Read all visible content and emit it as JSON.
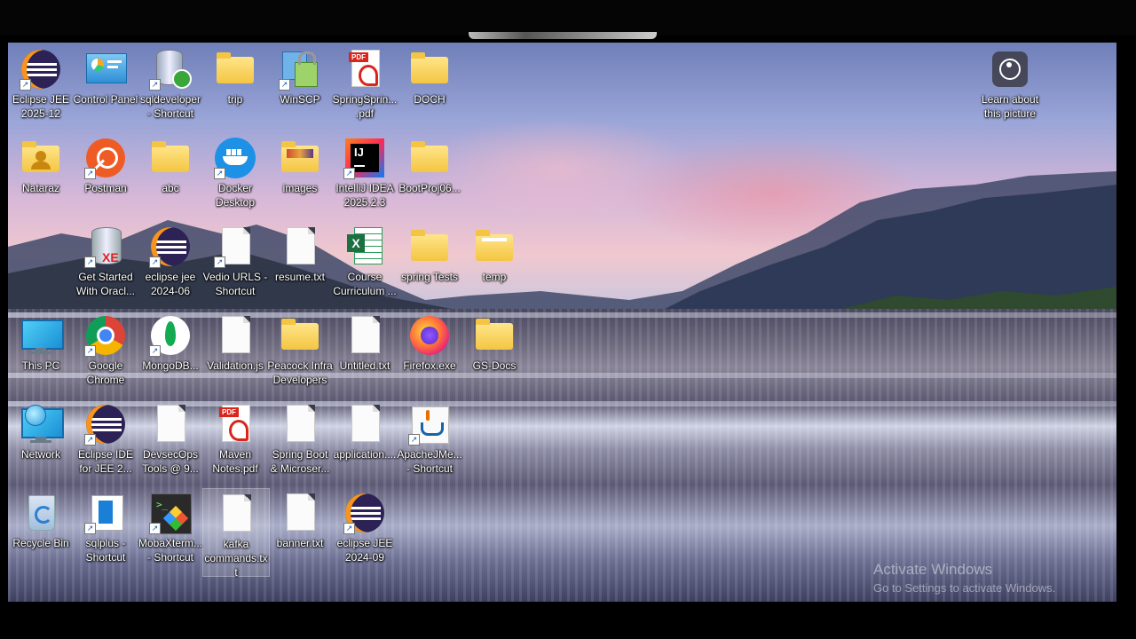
{
  "desktop": {
    "icons": [
      {
        "label": "Eclipse JEE\n2025-12",
        "icon": "eclipse-icon"
      },
      {
        "label": "Control Panel",
        "icon": "control-panel-icon"
      },
      {
        "label": "sqldeveloper\n- Shortcut",
        "icon": "sqldeveloper-icon"
      },
      {
        "label": "trip",
        "icon": "folder-icon"
      },
      {
        "label": "WinSCP",
        "icon": "winscp-icon"
      },
      {
        "label": "SpringSprin...\n.pdf",
        "icon": "pdf-icon"
      },
      {
        "label": "DOCH",
        "icon": "folder-icon"
      },
      {
        "label": "Nataraz",
        "icon": "user-folder-icon"
      },
      {
        "label": "Postman",
        "icon": "postman-icon"
      },
      {
        "label": "abc",
        "icon": "folder-icon"
      },
      {
        "label": "Docker\nDesktop",
        "icon": "docker-icon"
      },
      {
        "label": "images",
        "icon": "folder-icon"
      },
      {
        "label": "IntelliJ IDEA\n2025.2.3",
        "icon": "intellij-icon"
      },
      {
        "label": "BootProj06...",
        "icon": "folder-icon"
      },
      {
        "label": "Get Started\nWith Oracl...",
        "icon": "oracle-xe-icon"
      },
      {
        "label": "eclipse jee\n2024-06",
        "icon": "eclipse-icon"
      },
      {
        "label": "Vedio URLS -\nShortcut",
        "icon": "document-icon"
      },
      {
        "label": "resume.txt",
        "icon": "document-icon"
      },
      {
        "label": "Course\nCurriculum ...",
        "icon": "excel-icon"
      },
      {
        "label": "spring Tests",
        "icon": "folder-icon"
      },
      {
        "label": "temp",
        "icon": "folder-icon"
      },
      {
        "label": "This PC",
        "icon": "monitor-icon"
      },
      {
        "label": "Google\nChrome",
        "icon": "chrome-icon"
      },
      {
        "label": "MongoDB...",
        "icon": "mongodb-icon"
      },
      {
        "label": "Validation.js",
        "icon": "document-icon"
      },
      {
        "label": "Peacock Infra\nDevelopers",
        "icon": "folder-icon"
      },
      {
        "label": "Untitled.txt",
        "icon": "document-icon"
      },
      {
        "label": "Firefox.exe",
        "icon": "firefox-icon"
      },
      {
        "label": "GS-Docs",
        "icon": "folder-icon"
      },
      {
        "label": "Network",
        "icon": "network-icon"
      },
      {
        "label": "Eclipse IDE\nfor JEE 2...",
        "icon": "eclipse-icon"
      },
      {
        "label": "DevsecOps\nTools @ 9...",
        "icon": "document-icon"
      },
      {
        "label": "Maven\nNotes.pdf",
        "icon": "pdf-icon"
      },
      {
        "label": "Spring Boot\n& Microser...",
        "icon": "document-icon"
      },
      {
        "label": "application....",
        "icon": "document-icon"
      },
      {
        "label": "ApacheJMe...\n- Shortcut",
        "icon": "java-icon"
      },
      {
        "label": "Recycle Bin",
        "icon": "recycle-bin-icon"
      },
      {
        "label": "sqlplus -\nShortcut",
        "icon": "sqlplus-icon"
      },
      {
        "label": "MobaXterm...\n- Shortcut",
        "icon": "mobaxterm-icon"
      },
      {
        "label": "kafka\ncommands.tx\nt",
        "icon": "document-icon"
      },
      {
        "label": "banner.txt",
        "icon": "document-icon"
      },
      {
        "label": "eclipse JEE\n2024-09",
        "icon": "eclipse-icon"
      }
    ],
    "learn_label": "Learn about\nthis picture",
    "watermark": {
      "line1": "Activate Windows",
      "line2": "Go to Settings to activate Windows."
    }
  }
}
